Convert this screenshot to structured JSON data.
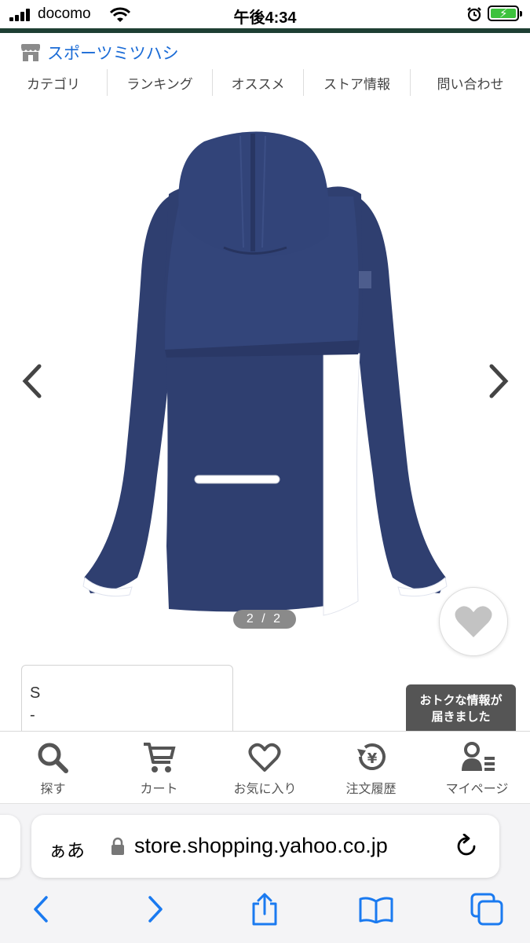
{
  "status_bar": {
    "carrier": "docomo",
    "time": "午後4:34",
    "battery_charging": true,
    "battery_color": "#3dc23d"
  },
  "store": {
    "name": "スポーツミツハシ",
    "icon": "store-icon",
    "accent_color": "#1a6bd6",
    "nav": [
      "カテゴリ",
      "ランキング",
      "オススメ",
      "ストア情報",
      "問い合わせ"
    ]
  },
  "gallery": {
    "page_indicator": "2 / 2",
    "prev_icon": "chevron-left-icon",
    "next_icon": "chevron-right-icon",
    "favorite_icon": "heart-icon"
  },
  "option": {
    "size": "S",
    "stock": "-"
  },
  "toast": {
    "line1": "おトクな情報が",
    "line2": "届きました"
  },
  "tab_bar": [
    {
      "label": "探す",
      "icon": "search-icon"
    },
    {
      "label": "カート",
      "icon": "cart-icon"
    },
    {
      "label": "お気に入り",
      "icon": "heart-icon"
    },
    {
      "label": "注文履歴",
      "icon": "order-history-icon"
    },
    {
      "label": "マイページ",
      "icon": "user-icon"
    }
  ],
  "browser": {
    "text_size_label": "ぁあ",
    "url": "store.shopping.yahoo.co.jp"
  }
}
